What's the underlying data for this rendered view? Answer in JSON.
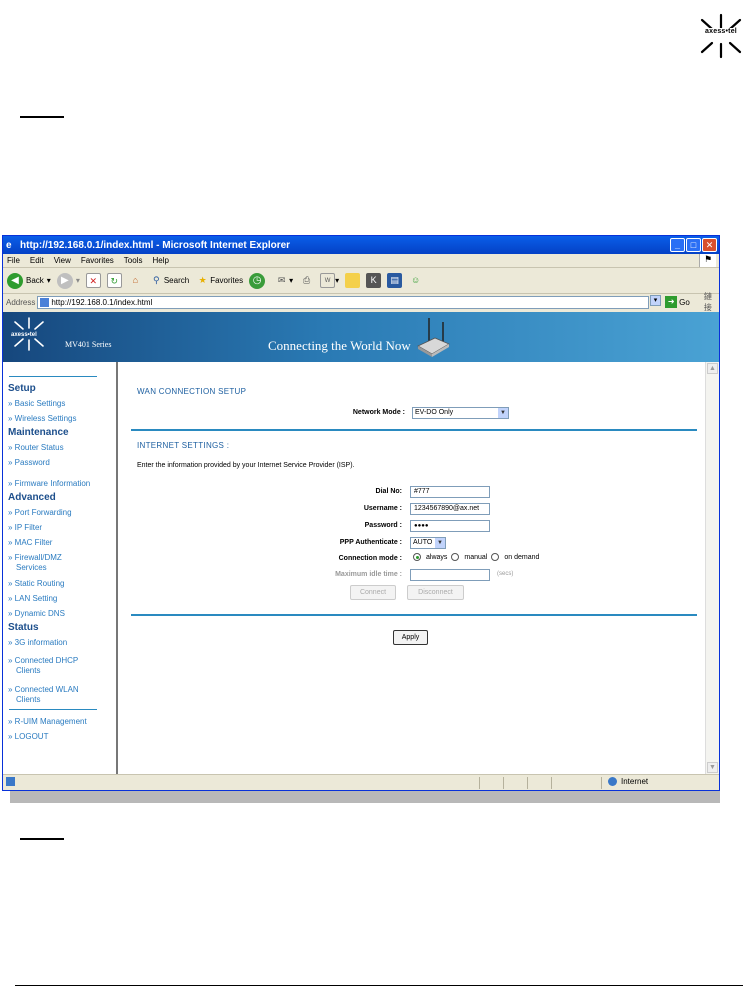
{
  "doc": {
    "logo_text": "axess•tel"
  },
  "browser": {
    "title": "http://192.168.0.1/index.html - Microsoft Internet Explorer",
    "menu": [
      "File",
      "Edit",
      "View",
      "Favorites",
      "Tools",
      "Help"
    ],
    "toolbar": {
      "back": "Back",
      "search": "Search",
      "favorites": "Favorites"
    },
    "address_label": "Address",
    "address": "http://192.168.0.1/index.html",
    "go": "Go",
    "links": "鏈接",
    "status_zone": "Internet"
  },
  "banner": {
    "series": "MV401 Series",
    "tagline": "Connecting the World Now",
    "brand": "axess•tel"
  },
  "sidebar": {
    "setup": "Setup",
    "basic_settings": "» Basic Settings",
    "wireless_settings": "» Wireless Settings",
    "maintenance": "Maintenance",
    "router_status": "» Router Status",
    "password": "» Password",
    "firmware": "» Firmware Information",
    "advanced": "Advanced",
    "port_forwarding": "» Port Forwarding",
    "ip_filter": "» IP Filter",
    "mac_filter": "» MAC Filter",
    "firewall_line1": "» Firewall/DMZ",
    "firewall_line2": "Services",
    "static_routing": "» Static Routing",
    "lan_setting": "» LAN Setting",
    "dynamic_dns": "» Dynamic DNS",
    "status": "Status",
    "g3_info": "» 3G information",
    "dhcp_line1": "» Connected DHCP",
    "dhcp_line2": "Clients",
    "wlan_line1": "» Connected WLAN",
    "wlan_line2": "Clients",
    "ruim": "» R-UIM Management",
    "logout": "» LOGOUT"
  },
  "form": {
    "wan_title": "WAN CONNECTION SETUP",
    "network_mode_label": "Network Mode :",
    "network_mode_value": "EV-DO Only",
    "internet_title": "INTERNET SETTINGS :",
    "intro": "Enter the information provided by your Internet Service Provider (ISP).",
    "dial_label": "Dial No:",
    "dial_value": "#777",
    "username_label": "Username :",
    "username_value": "1234567890@ax.net",
    "password_label": "Password :",
    "password_value": "●●●●",
    "ppp_label": "PPP Authenticate :",
    "ppp_value": "AUTO",
    "conn_mode_label": "Connection mode :",
    "mode_always": "always",
    "mode_manual": "manual",
    "mode_on_demand": "on demand",
    "idle_label": "Maximum idle time :",
    "idle_unit": "(secs)",
    "connect": "Connect",
    "disconnect": "Disconnect",
    "apply": "Apply"
  }
}
